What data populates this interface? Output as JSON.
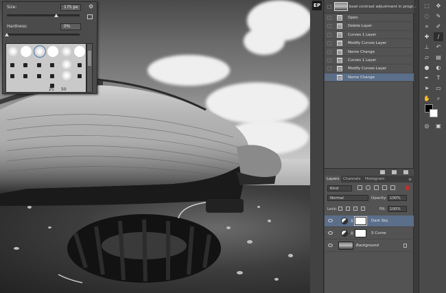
{
  "brush_panel": {
    "size_label": "Size:",
    "size_value": "175 px",
    "hardness_label": "Hardness:",
    "hardness_value": "0%",
    "size_slider_fraction": 0.68,
    "hardness_slider_fraction": 0.0,
    "brush_numbers": [
      "25",
      "50"
    ]
  },
  "dock": {
    "ep_label": "EP"
  },
  "history": {
    "snapshot_label": "boat contrast adjustment in progr...",
    "items": [
      {
        "label": "Open"
      },
      {
        "label": "Delete Layer"
      },
      {
        "label": "Curves 1 Layer"
      },
      {
        "label": "Modify Curves Layer"
      },
      {
        "label": "Name Change"
      },
      {
        "label": "Curves 1 Layer"
      },
      {
        "label": "Modify Curves Layer"
      },
      {
        "label": "Name Change",
        "active": true
      }
    ]
  },
  "layers_panel": {
    "tabs": [
      "Layers",
      "Channels",
      "Histogram"
    ],
    "filter_label": "Kind",
    "blend_mode": "Normal",
    "opacity_label": "Opacity:",
    "opacity_value": "100%",
    "lock_label": "Lock:",
    "fill_label": "Fill:",
    "fill_value": "100%",
    "layers": [
      {
        "name": "Dark Sky",
        "active": true
      },
      {
        "name": "S Curve"
      },
      {
        "name": "Background"
      }
    ]
  },
  "colors": {
    "foreground": "#000000",
    "background": "#ffffff",
    "selection": "#5b6e8a"
  },
  "tools": [
    "marquee-icon",
    "lasso-icon",
    "quick-select-icon",
    "crop-icon",
    "eyedropper-icon",
    "healing-icon",
    "brush-icon",
    "clone-stamp-icon",
    "history-brush-icon",
    "eraser-icon",
    "gradient-icon",
    "blur-icon",
    "dodge-icon",
    "pen-icon",
    "type-icon",
    "path-select-icon",
    "shape-icon",
    "hand-icon",
    "zoom-icon"
  ]
}
